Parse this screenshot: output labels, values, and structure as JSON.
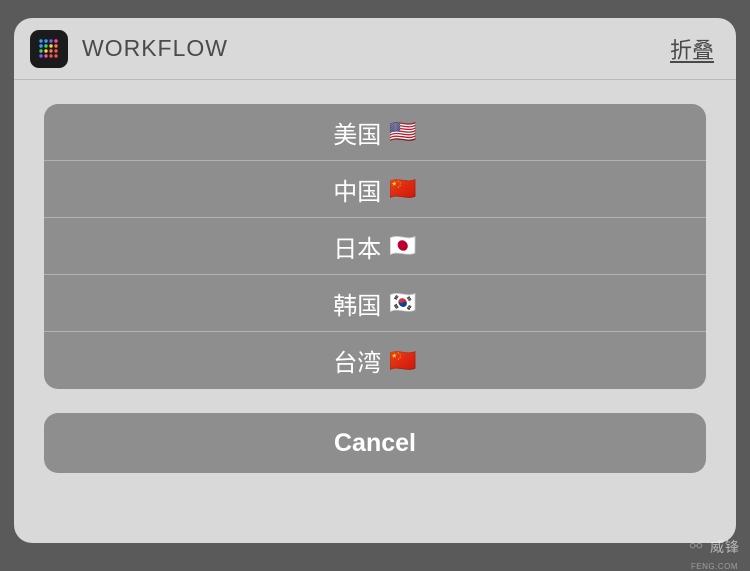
{
  "header": {
    "title": "WORKFLOW",
    "collapse_label": "折叠"
  },
  "options": [
    {
      "label": "美国",
      "flag": "🇺🇸"
    },
    {
      "label": "中国",
      "flag": "🇨🇳"
    },
    {
      "label": "日本",
      "flag": "🇯🇵"
    },
    {
      "label": "韩国",
      "flag": "🇰🇷"
    },
    {
      "label": "台湾",
      "flag": "🇨🇳"
    }
  ],
  "cancel_label": "Cancel",
  "watermark": {
    "text": "威锋",
    "sub": "FENG.COM"
  }
}
